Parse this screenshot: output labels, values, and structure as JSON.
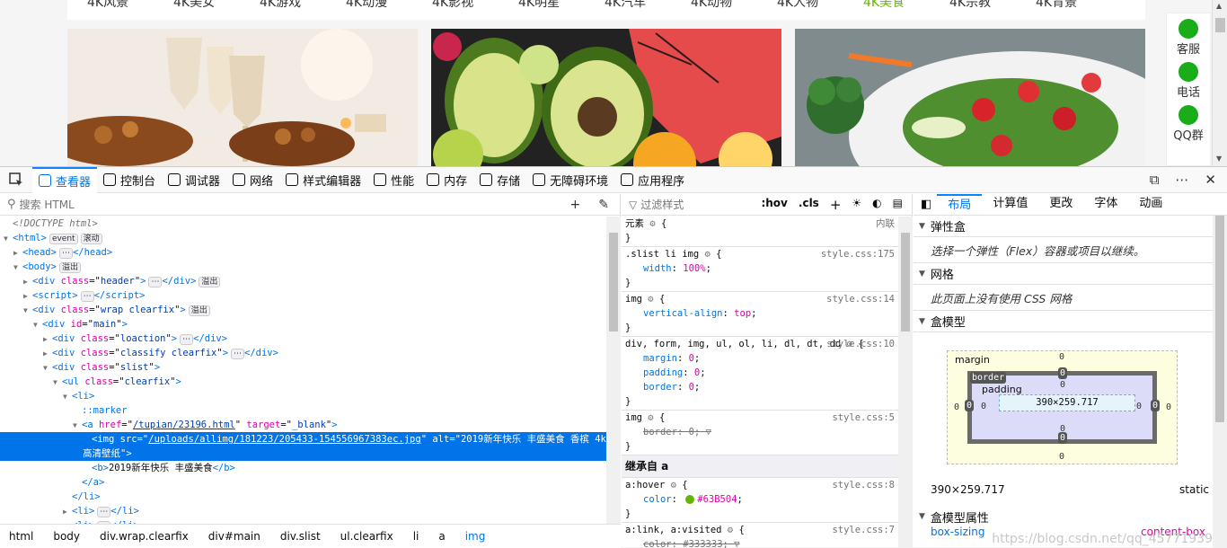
{
  "page": {
    "nav_items": [
      "4K风景",
      "4K美女",
      "4K游戏",
      "4K动漫",
      "4K影视",
      "4K明星",
      "4K汽车",
      "4K动物",
      "4K人物",
      "4K美食",
      "4K宗教",
      "4K背景"
    ],
    "active_nav": "4K美食",
    "float_items": [
      {
        "label": "客服",
        "icon": "chat-bubble-icon"
      },
      {
        "label": "电话",
        "icon": "phone-icon"
      },
      {
        "label": "QQ群",
        "icon": "qq-icon"
      }
    ],
    "colors": {
      "accent": "#63B504",
      "devtools_blue": "#0074e8"
    }
  },
  "devtools": {
    "tabs": [
      {
        "label": "查看器",
        "icon": "inspector-icon",
        "active": true
      },
      {
        "label": "控制台",
        "icon": "console-icon"
      },
      {
        "label": "调试器",
        "icon": "debugger-icon"
      },
      {
        "label": "网络",
        "icon": "network-icon"
      },
      {
        "label": "样式编辑器",
        "icon": "style-editor-icon"
      },
      {
        "label": "性能",
        "icon": "performance-icon"
      },
      {
        "label": "内存",
        "icon": "memory-icon"
      },
      {
        "label": "存储",
        "icon": "storage-icon"
      },
      {
        "label": "无障碍环境",
        "icon": "accessibility-icon"
      },
      {
        "label": "应用程序",
        "icon": "application-icon"
      }
    ],
    "toolbar_right": {
      "dock": "⧉",
      "more": "⋯",
      "close": "✕"
    },
    "search_placeholder": "搜索 HTML",
    "markup": {
      "doctype": "<!DOCTYPE html>",
      "html_badges": [
        "event",
        "滚动"
      ],
      "head": "<head>",
      "head_close": "</head>",
      "body": "<body>",
      "body_badge": "溢出",
      "div_header": {
        "tag": "div",
        "attr": "class",
        "value": "header",
        "badge": "溢出"
      },
      "script": "<script>",
      "div_wrap": {
        "tag": "div",
        "attr": "class",
        "value": "wrap clearfix",
        "badge": "溢出"
      },
      "div_main": {
        "tag": "div",
        "attr": "id",
        "value": "main"
      },
      "div_loaction": {
        "tag": "div",
        "attr": "class",
        "value": "loaction"
      },
      "div_classify": {
        "tag": "div",
        "attr": "class",
        "value": "classify clearfix"
      },
      "div_slist": {
        "tag": "div",
        "attr": "class",
        "value": "slist"
      },
      "ul": {
        "tag": "ul",
        "attr": "class",
        "value": "clearfix"
      },
      "li": "<li>",
      "marker": "::marker",
      "a_href": "/tupian/23196.html",
      "a_target": "_blank",
      "img_src": "/uploads/allimg/181223/205433-154556967383ec.jpg",
      "img_alt": "2019新年快乐 丰盛美食 香槟 4k高清壁纸",
      "b_text": "2019新年快乐 丰盛美食",
      "a_close": "</a>",
      "li_close": "</li>"
    },
    "breadcrumbs": [
      "html",
      "body",
      "div.wrap.clearfix",
      "div#main",
      "div.slist",
      "ul.clearfix",
      "li",
      "a",
      "img"
    ],
    "rules_filter_placeholder": "过滤样式",
    "rules_buttons": [
      ":hov",
      ".cls"
    ],
    "rules": [
      {
        "selector": "元素",
        "source": "内联",
        "decls": []
      },
      {
        "selector": ".slist li img",
        "source": "style.css:175",
        "decls": [
          {
            "p": "width",
            "v": "100%"
          }
        ]
      },
      {
        "selector": "img",
        "source": "style.css:14",
        "decls": [
          {
            "p": "vertical-align",
            "v": "top"
          }
        ]
      },
      {
        "selector": "div, form, img, ul, ol, li, dl, dt, dd",
        "source": "style.css:10",
        "decls": [
          {
            "p": "margin",
            "v": "0"
          },
          {
            "p": "padding",
            "v": "0"
          },
          {
            "p": "border",
            "v": "0"
          }
        ]
      },
      {
        "selector": "img",
        "source": "style.css:5",
        "decls": [
          {
            "p": "border",
            "v": "0",
            "struck": true
          }
        ]
      }
    ],
    "inherited_header": "继承自 a",
    "inherited_rules": [
      {
        "selector": "a:hover",
        "source": "style.css:8",
        "decls": [
          {
            "p": "color",
            "v": "#63B504",
            "swatch": true
          }
        ]
      },
      {
        "selector": "a:link, a:visited",
        "source": "style.css:7",
        "decls": [
          {
            "p": "color",
            "v": "#333333",
            "struck": true
          }
        ]
      }
    ],
    "layout_tabs": [
      "布局",
      "计算值",
      "更改",
      "字体",
      "动画"
    ],
    "flexbox_title": "弹性盒",
    "flexbox_msg": "选择一个弹性（Flex）容器或项目以继续。",
    "grid_title": "网格",
    "grid_msg": "此页面上没有使用 CSS 网格",
    "boxmodel_title": "盒模型",
    "boxmodel": {
      "margin_label": "margin",
      "border_label": "border",
      "padding_label": "padding",
      "content": "390×259.717",
      "margin": {
        "top": "0",
        "right": "0",
        "bottom": "0",
        "left": "0"
      },
      "border": {
        "top": "0",
        "right": "0",
        "bottom": "0",
        "left": "0"
      },
      "padding": {
        "top": "0",
        "right": "0",
        "bottom": "0",
        "left": "0"
      },
      "size": "390×259.717",
      "position": "static"
    },
    "bm_props_title": "盒模型属性",
    "bm_props": [
      {
        "p": "box-sizing",
        "v": "content-box"
      }
    ],
    "watermark": "https://blog.csdn.net/qq_45771939"
  }
}
